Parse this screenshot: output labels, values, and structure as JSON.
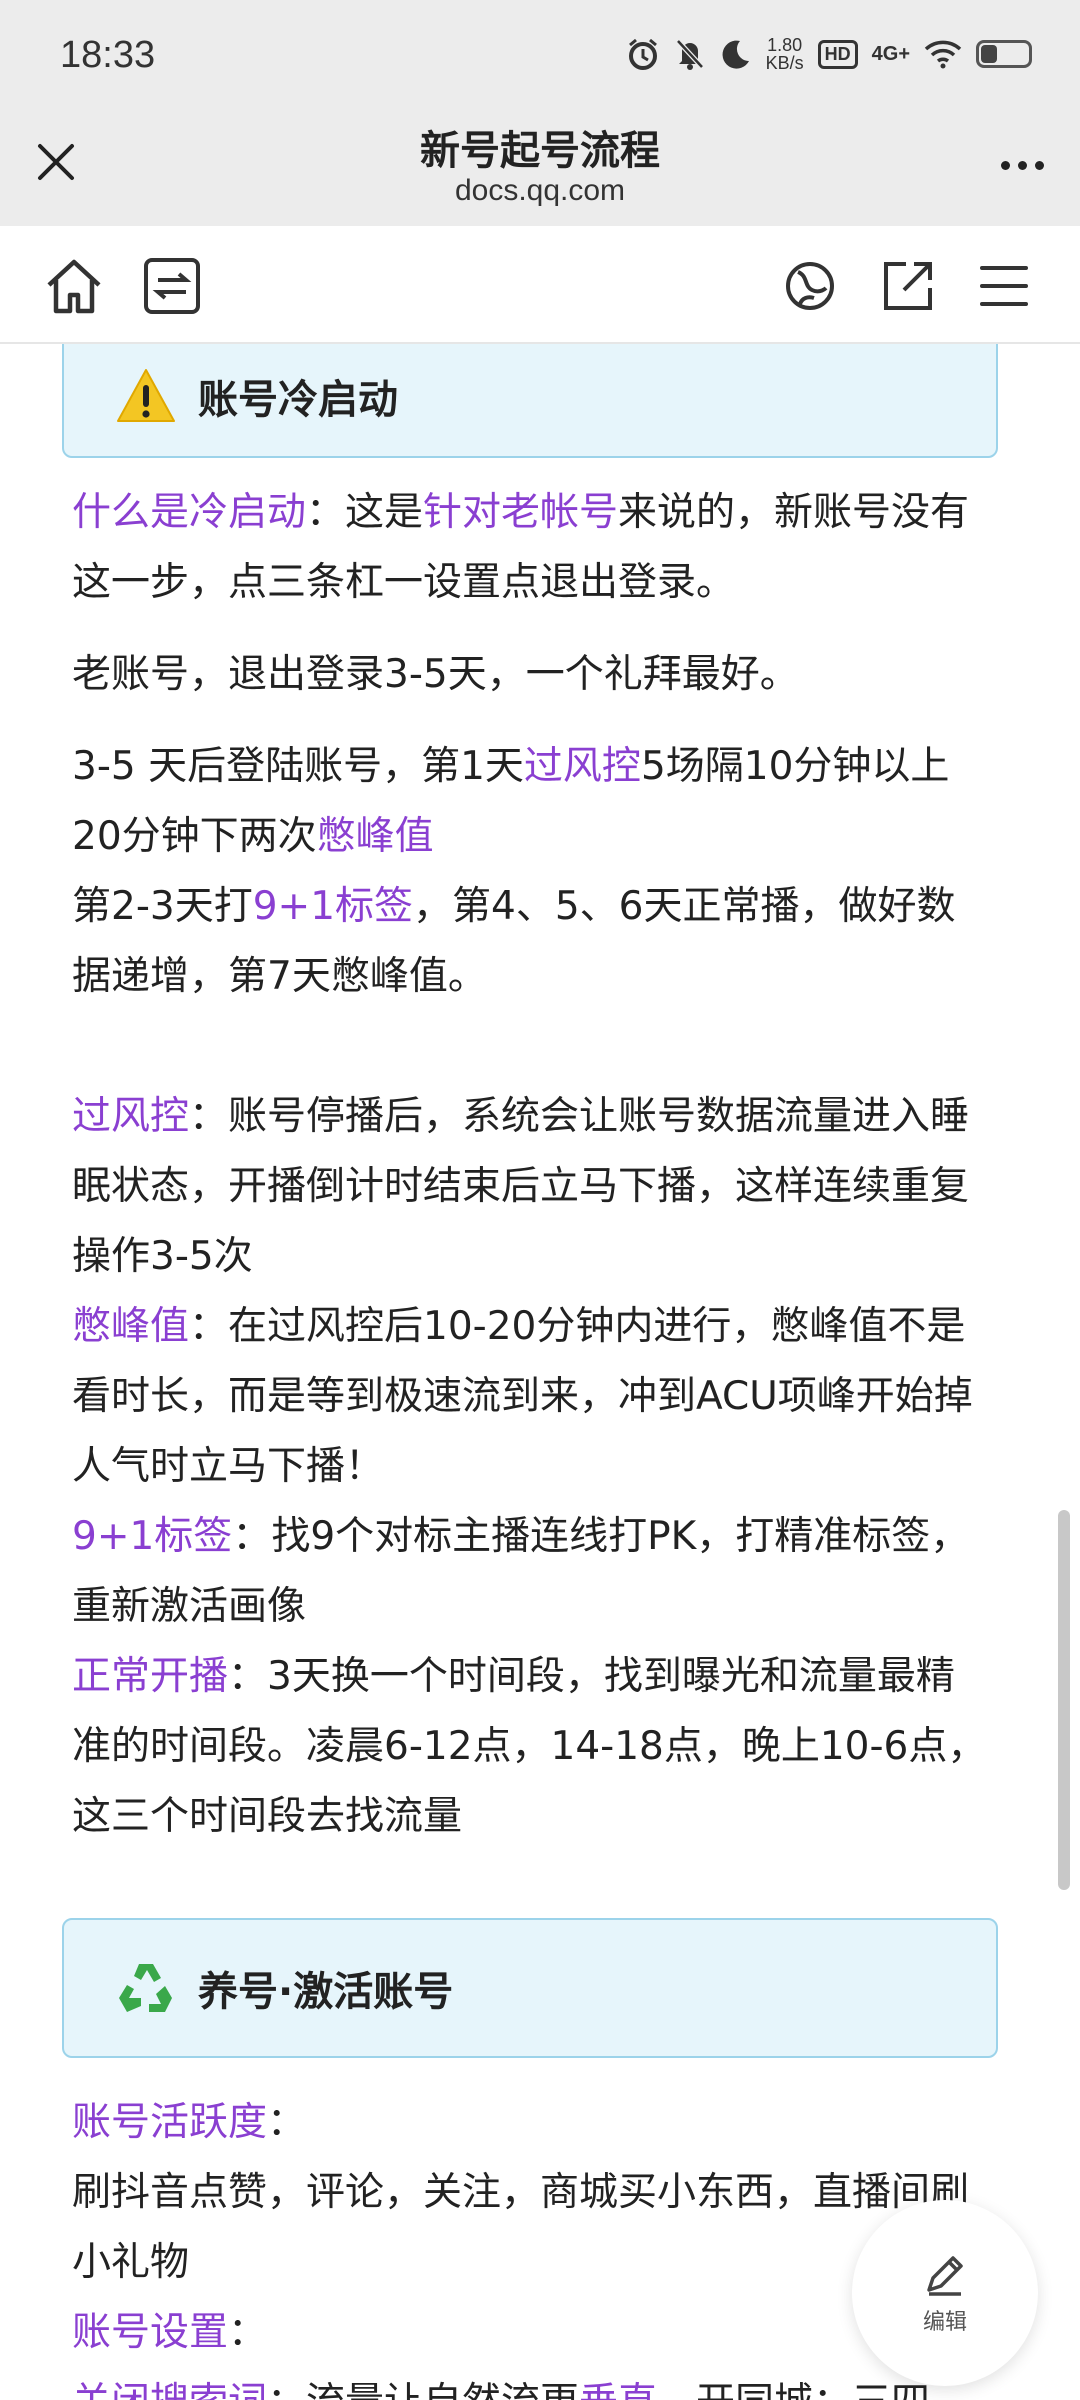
{
  "status_bar": {
    "time": "18:33",
    "speed_value": "1.80",
    "speed_unit": "KB/s",
    "hd": "HD",
    "network": "4G+",
    "battery_level": 0.35
  },
  "title_bar": {
    "title": "新号起号流程",
    "url": "docs.qq.com"
  },
  "section1": {
    "title": "账号冷启动"
  },
  "p1": {
    "hl1": "什么是冷启动",
    "t1": "：这是",
    "hl2": "针对老帐号",
    "t2": "来说的，新账号没有这一步，点三条杠一设置点退出登录。"
  },
  "p2": {
    "t1": "老账号，退出登录3-5天，一个礼拜最好。"
  },
  "p3": {
    "t1": "3-5 天后登陆账号，第1天",
    "hl1": "过风控",
    "t2": "5场隔10分钟以上20分钟下两次",
    "hl2": "憋峰值"
  },
  "p4": {
    "t1": "第2-3天打",
    "hl1": "9+1标签",
    "t2": "，第4、5、6天正常播，做好数据递增，第7天憋峰值。"
  },
  "p5": {
    "hl1": "过风控",
    "t1": "：账号停播后，系统会让账号数据流量进入睡眠状态，开播倒计时结束后立马下播，这样连续重复操作3-5次"
  },
  "p6": {
    "hl1": "憋峰值",
    "t1": "：在过风控后10-20分钟内进行，憋峰值不是看时长，而是等到极速流到来，冲到ACU项峰开始掉人气时立马下播！"
  },
  "p7": {
    "hl1": "9+1标签",
    "t1": "：找9个对标主播连线打PK，打精准标签，重新激活画像"
  },
  "p8": {
    "hl1": "正常开播",
    "t1": "：3天换一个时间段，找到曝光和流量最精准的时间段。凌晨6-12点，14-18点，晚上10-6点，这三个时间段去找流量"
  },
  "section2": {
    "title": "养号·激活账号"
  },
  "p9": {
    "hl1": "账号活跃度",
    "t1": "："
  },
  "p10": {
    "t1": "刷抖音点赞，评论，关注，商城买小东西，直播间刷小礼物"
  },
  "p11": {
    "hl1": "账号设置",
    "t1": "："
  },
  "p12": {
    "hl1": "关闭搜索词",
    "t1": "：流量让自然流更",
    "hl2": "垂直",
    "t2": "，开同城：三四"
  },
  "fab": {
    "label": "编辑"
  },
  "colors": {
    "highlight": "#8a3fd1",
    "callout_bg": "#e6f5fb",
    "callout_border": "#9cd3ea"
  }
}
